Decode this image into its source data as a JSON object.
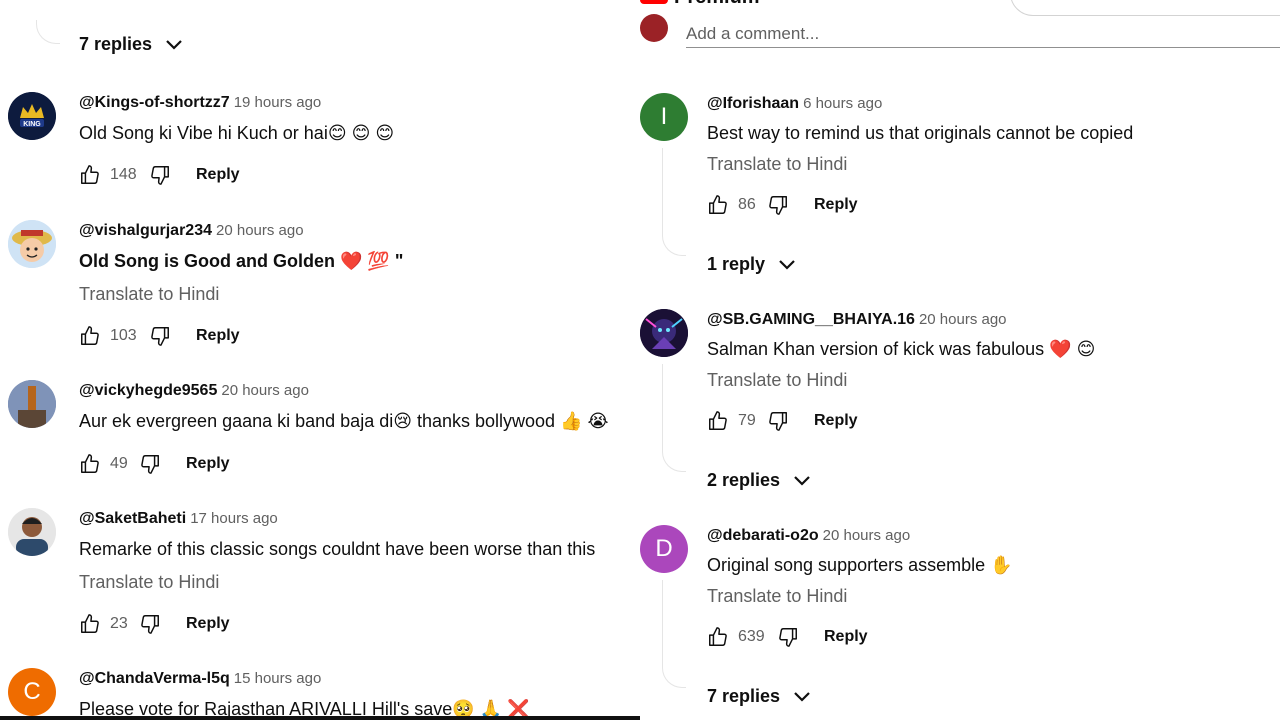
{
  "left": {
    "top_replies": "7 replies",
    "comments": [
      {
        "author": "@Kings-of-shortzz7",
        "time": "19 hours ago",
        "text": "Old Song ki Vibe hi Kuch or hai😊 😊 😊",
        "likes": "148",
        "reply": "Reply",
        "translate": ""
      },
      {
        "author": "@vishalgurjar234",
        "time": "20 hours ago",
        "text": "Old Song is Good and Golden ❤️ 💯 \"",
        "likes": "103",
        "reply": "Reply",
        "translate": "Translate to Hindi"
      },
      {
        "author": "@vickyhegde9565",
        "time": "20 hours ago",
        "text": "Aur ek evergreen gaana ki band baja di😢 thanks bollywood 👍 😭",
        "likes": "49",
        "reply": "Reply",
        "translate": ""
      },
      {
        "author": "@SaketBaheti",
        "time": "17 hours ago",
        "text": "Remarke of this classic songs couldnt have been worse than this",
        "likes": "23",
        "reply": "Reply",
        "translate": "Translate to Hindi"
      },
      {
        "author": "@ChandaVerma-l5q",
        "time": "15 hours ago",
        "text": "Please vote for Rajasthan ARIVALLI Hill's save🥺 🙏 ❌",
        "avatar_letter": "C"
      }
    ]
  },
  "right": {
    "brand_fragment": "Premium",
    "add_comment_placeholder": "Add a comment...",
    "comments": [
      {
        "author": "@Iforishaan",
        "time": "6 hours ago",
        "text": "Best way to remind us that originals cannot be copied",
        "translate": "Translate to Hindi",
        "likes": "86",
        "reply": "Reply",
        "replies": "1 reply",
        "avatar_letter": "I"
      },
      {
        "author": "@SB.GAMING__BHAIYA.16",
        "time": "20 hours ago",
        "text": "Salman Khan version of kick was fabulous ❤️ 😊",
        "translate": "Translate to Hindi",
        "likes": "79",
        "reply": "Reply",
        "replies": "2 replies"
      },
      {
        "author": "@debarati-o2o",
        "time": "20 hours ago",
        "text": "Original song supporters assemble ✋",
        "translate": "Translate to Hindi",
        "likes": "639",
        "reply": "Reply",
        "replies": "7 replies",
        "avatar_letter": "D"
      }
    ]
  },
  "colors": {
    "avatar_green": "#2e7d32",
    "avatar_purple": "#ab47bc",
    "avatar_orange": "#ef6c00",
    "text_primary": "#0f0f0f",
    "text_secondary": "#606060"
  },
  "icons": [
    "thumbs-up-icon",
    "thumbs-down-icon",
    "chevron-down-icon"
  ]
}
